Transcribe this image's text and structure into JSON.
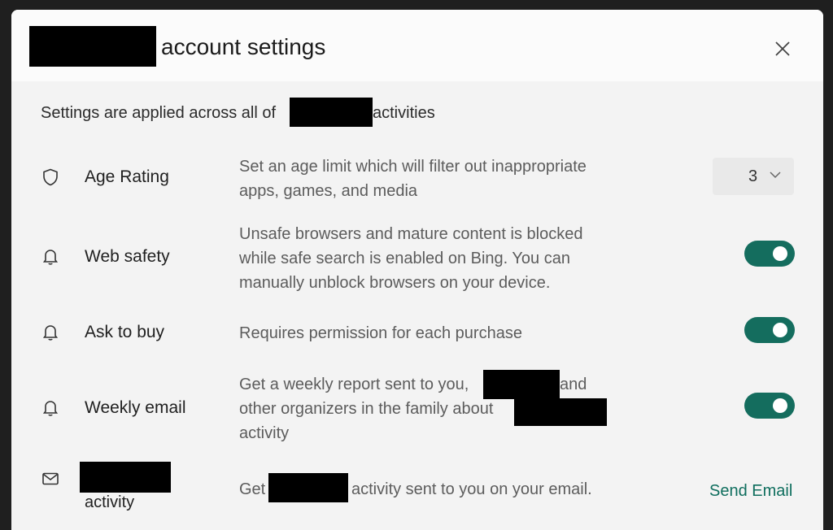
{
  "dialog": {
    "title": "account settings",
    "close_icon": "close-icon",
    "subtitle_lead": "Settings are applied across all of",
    "subtitle_tail": "activities"
  },
  "settings": {
    "age_rating": {
      "label": "Age Rating",
      "icon": "shield-icon",
      "description": "Set an age limit which will filter out inappropriate apps, games, and media",
      "value": "3"
    },
    "web_safety": {
      "label": "Web safety",
      "icon": "bell-icon",
      "description": "Unsafe browsers and mature content is blocked while safe search is enabled on Bing. You can manually unblock browsers on your device.",
      "enabled": true
    },
    "ask_to_buy": {
      "label": "Ask to buy",
      "icon": "bell-icon",
      "description": "Requires permission for each purchase",
      "enabled": true
    },
    "weekly_email": {
      "label": "Weekly email",
      "icon": "bell-icon",
      "desc_line1": "Get a weekly report sent to you,",
      "desc_line1_tail": "and",
      "desc_line2": "other organizers in the family about",
      "desc_line3": "activity",
      "enabled": true
    },
    "activity": {
      "label": "activity",
      "icon": "mail-icon",
      "desc_lead": "Get",
      "desc_tail": "activity sent to you on your email.",
      "action": "Send Email"
    }
  },
  "colors": {
    "accent": "#146d5e",
    "link": "#0f6e5e",
    "background": "#f3f3f3"
  }
}
